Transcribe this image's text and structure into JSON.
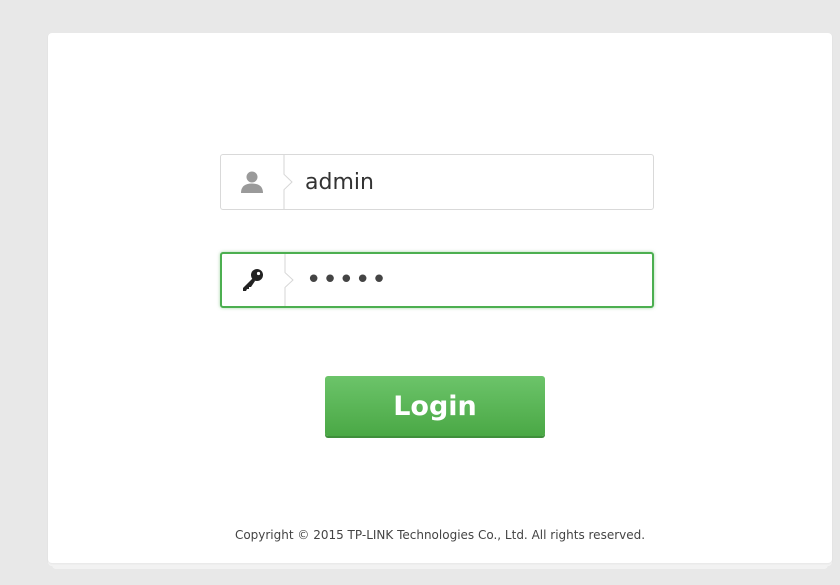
{
  "login_form": {
    "username": {
      "icon": "user-icon",
      "value": "admin"
    },
    "password": {
      "icon": "key-icon",
      "value": "*****"
    },
    "login_button_label": "Login"
  },
  "footer": {
    "copyright": "Copyright © 2015 TP-LINK Technologies Co., Ltd. All rights reserved."
  },
  "colors": {
    "background": "#e8e8e8",
    "card": "#ffffff",
    "accent_green": "#4caf50",
    "button_green": "#5cb85c"
  }
}
